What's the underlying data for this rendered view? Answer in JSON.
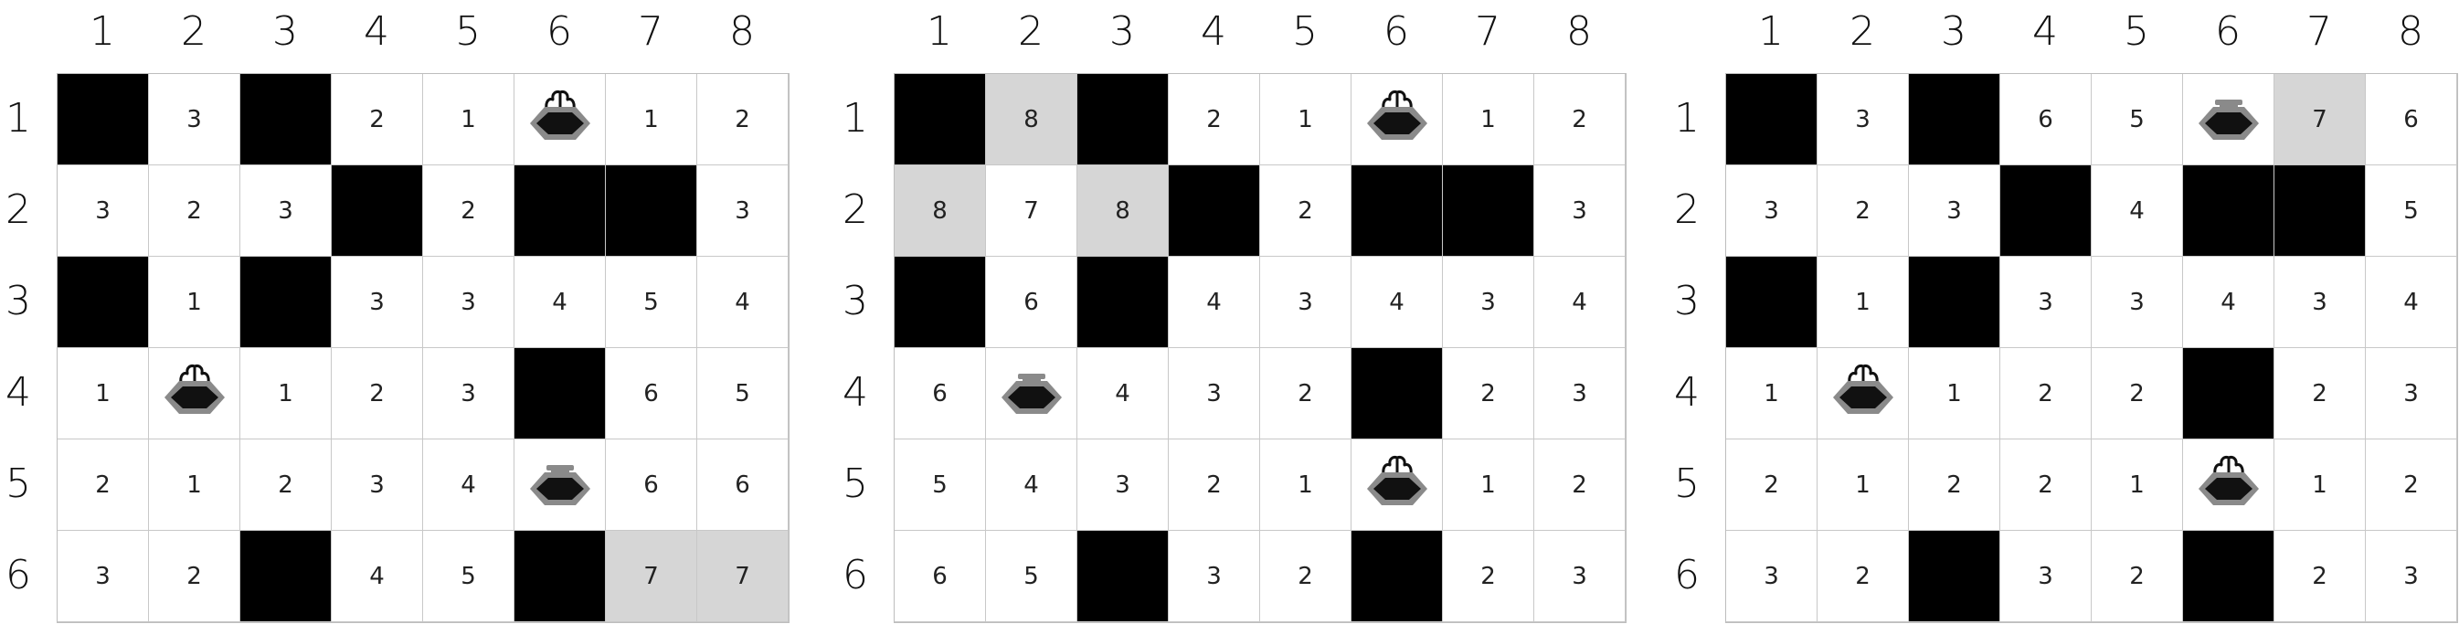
{
  "panels": [
    {
      "col_labels": [
        "1",
        "2",
        "3",
        "4",
        "5",
        "6",
        "7",
        "8"
      ],
      "row_labels": [
        "1",
        "2",
        "3",
        "4",
        "5",
        "6"
      ],
      "cells": [
        [
          {
            "t": "black",
            "v": ""
          },
          {
            "t": "num",
            "v": "3"
          },
          {
            "t": "black",
            "v": ""
          },
          {
            "t": "num",
            "v": "2"
          },
          {
            "t": "num",
            "v": "1"
          },
          {
            "t": "fountain",
            "v": ""
          },
          {
            "t": "num",
            "v": "1"
          },
          {
            "t": "num",
            "v": "2"
          }
        ],
        [
          {
            "t": "num",
            "v": "3"
          },
          {
            "t": "num",
            "v": "2"
          },
          {
            "t": "num",
            "v": "3"
          },
          {
            "t": "black",
            "v": ""
          },
          {
            "t": "num",
            "v": "2"
          },
          {
            "t": "black",
            "v": ""
          },
          {
            "t": "black",
            "v": ""
          },
          {
            "t": "num",
            "v": "3"
          }
        ],
        [
          {
            "t": "black",
            "v": ""
          },
          {
            "t": "num",
            "v": "1"
          },
          {
            "t": "black",
            "v": ""
          },
          {
            "t": "num",
            "v": "3"
          },
          {
            "t": "num",
            "v": "3"
          },
          {
            "t": "num",
            "v": "4"
          },
          {
            "t": "num",
            "v": "5"
          },
          {
            "t": "num",
            "v": "4"
          }
        ],
        [
          {
            "t": "num",
            "v": "1"
          },
          {
            "t": "fountain",
            "v": ""
          },
          {
            "t": "num",
            "v": "1"
          },
          {
            "t": "num",
            "v": "2"
          },
          {
            "t": "num",
            "v": "3"
          },
          {
            "t": "black",
            "v": ""
          },
          {
            "t": "num",
            "v": "6"
          },
          {
            "t": "num",
            "v": "5"
          }
        ],
        [
          {
            "t": "num",
            "v": "2"
          },
          {
            "t": "num",
            "v": "1"
          },
          {
            "t": "num",
            "v": "2"
          },
          {
            "t": "num",
            "v": "3"
          },
          {
            "t": "num",
            "v": "4"
          },
          {
            "t": "capped",
            "v": ""
          },
          {
            "t": "num",
            "v": "6"
          },
          {
            "t": "num",
            "v": "6"
          }
        ],
        [
          {
            "t": "num",
            "v": "3"
          },
          {
            "t": "num",
            "v": "2"
          },
          {
            "t": "black",
            "v": ""
          },
          {
            "t": "num",
            "v": "4"
          },
          {
            "t": "num",
            "v": "5"
          },
          {
            "t": "black",
            "v": ""
          },
          {
            "t": "gray",
            "v": "7"
          },
          {
            "t": "gray",
            "v": "7"
          }
        ]
      ]
    },
    {
      "col_labels": [
        "1",
        "2",
        "3",
        "4",
        "5",
        "6",
        "7",
        "8"
      ],
      "row_labels": [
        "1",
        "2",
        "3",
        "4",
        "5",
        "6"
      ],
      "cells": [
        [
          {
            "t": "black",
            "v": ""
          },
          {
            "t": "gray",
            "v": "8"
          },
          {
            "t": "black",
            "v": ""
          },
          {
            "t": "num",
            "v": "2"
          },
          {
            "t": "num",
            "v": "1"
          },
          {
            "t": "fountain",
            "v": ""
          },
          {
            "t": "num",
            "v": "1"
          },
          {
            "t": "num",
            "v": "2"
          }
        ],
        [
          {
            "t": "gray",
            "v": "8"
          },
          {
            "t": "num",
            "v": "7"
          },
          {
            "t": "gray",
            "v": "8"
          },
          {
            "t": "black",
            "v": ""
          },
          {
            "t": "num",
            "v": "2"
          },
          {
            "t": "black",
            "v": ""
          },
          {
            "t": "black",
            "v": ""
          },
          {
            "t": "num",
            "v": "3"
          }
        ],
        [
          {
            "t": "black",
            "v": ""
          },
          {
            "t": "num",
            "v": "6"
          },
          {
            "t": "black",
            "v": ""
          },
          {
            "t": "num",
            "v": "4"
          },
          {
            "t": "num",
            "v": "3"
          },
          {
            "t": "num",
            "v": "4"
          },
          {
            "t": "num",
            "v": "3"
          },
          {
            "t": "num",
            "v": "4"
          }
        ],
        [
          {
            "t": "num",
            "v": "6"
          },
          {
            "t": "capped",
            "v": ""
          },
          {
            "t": "num",
            "v": "4"
          },
          {
            "t": "num",
            "v": "3"
          },
          {
            "t": "num",
            "v": "2"
          },
          {
            "t": "black",
            "v": ""
          },
          {
            "t": "num",
            "v": "2"
          },
          {
            "t": "num",
            "v": "3"
          }
        ],
        [
          {
            "t": "num",
            "v": "5"
          },
          {
            "t": "num",
            "v": "4"
          },
          {
            "t": "num",
            "v": "3"
          },
          {
            "t": "num",
            "v": "2"
          },
          {
            "t": "num",
            "v": "1"
          },
          {
            "t": "fountain",
            "v": ""
          },
          {
            "t": "num",
            "v": "1"
          },
          {
            "t": "num",
            "v": "2"
          }
        ],
        [
          {
            "t": "num",
            "v": "6"
          },
          {
            "t": "num",
            "v": "5"
          },
          {
            "t": "black",
            "v": ""
          },
          {
            "t": "num",
            "v": "3"
          },
          {
            "t": "num",
            "v": "2"
          },
          {
            "t": "black",
            "v": ""
          },
          {
            "t": "num",
            "v": "2"
          },
          {
            "t": "num",
            "v": "3"
          }
        ]
      ]
    },
    {
      "col_labels": [
        "1",
        "2",
        "3",
        "4",
        "5",
        "6",
        "7",
        "8"
      ],
      "row_labels": [
        "1",
        "2",
        "3",
        "4",
        "5",
        "6"
      ],
      "cells": [
        [
          {
            "t": "black",
            "v": ""
          },
          {
            "t": "num",
            "v": "3"
          },
          {
            "t": "black",
            "v": ""
          },
          {
            "t": "num",
            "v": "6"
          },
          {
            "t": "num",
            "v": "5"
          },
          {
            "t": "capped",
            "v": ""
          },
          {
            "t": "gray",
            "v": "7"
          },
          {
            "t": "num",
            "v": "6"
          }
        ],
        [
          {
            "t": "num",
            "v": "3"
          },
          {
            "t": "num",
            "v": "2"
          },
          {
            "t": "num",
            "v": "3"
          },
          {
            "t": "black",
            "v": ""
          },
          {
            "t": "num",
            "v": "4"
          },
          {
            "t": "black",
            "v": ""
          },
          {
            "t": "black",
            "v": ""
          },
          {
            "t": "num",
            "v": "5"
          }
        ],
        [
          {
            "t": "black",
            "v": ""
          },
          {
            "t": "num",
            "v": "1"
          },
          {
            "t": "black",
            "v": ""
          },
          {
            "t": "num",
            "v": "3"
          },
          {
            "t": "num",
            "v": "3"
          },
          {
            "t": "num",
            "v": "4"
          },
          {
            "t": "num",
            "v": "3"
          },
          {
            "t": "num",
            "v": "4"
          }
        ],
        [
          {
            "t": "num",
            "v": "1"
          },
          {
            "t": "fountain",
            "v": ""
          },
          {
            "t": "num",
            "v": "1"
          },
          {
            "t": "num",
            "v": "2"
          },
          {
            "t": "num",
            "v": "2"
          },
          {
            "t": "black",
            "v": ""
          },
          {
            "t": "num",
            "v": "2"
          },
          {
            "t": "num",
            "v": "3"
          }
        ],
        [
          {
            "t": "num",
            "v": "2"
          },
          {
            "t": "num",
            "v": "1"
          },
          {
            "t": "num",
            "v": "2"
          },
          {
            "t": "num",
            "v": "2"
          },
          {
            "t": "num",
            "v": "1"
          },
          {
            "t": "fountain",
            "v": ""
          },
          {
            "t": "num",
            "v": "1"
          },
          {
            "t": "num",
            "v": "2"
          }
        ],
        [
          {
            "t": "num",
            "v": "3"
          },
          {
            "t": "num",
            "v": "2"
          },
          {
            "t": "black",
            "v": ""
          },
          {
            "t": "num",
            "v": "3"
          },
          {
            "t": "num",
            "v": "2"
          },
          {
            "t": "black",
            "v": ""
          },
          {
            "t": "num",
            "v": "2"
          },
          {
            "t": "num",
            "v": "3"
          }
        ]
      ]
    }
  ],
  "icons": {
    "fountain": "fountain-icon",
    "capped": "capped-fountain-icon"
  },
  "colors": {
    "wall": "#000000",
    "highlight": "#d6d6d6",
    "icon_rim": "#8a8a8a"
  }
}
